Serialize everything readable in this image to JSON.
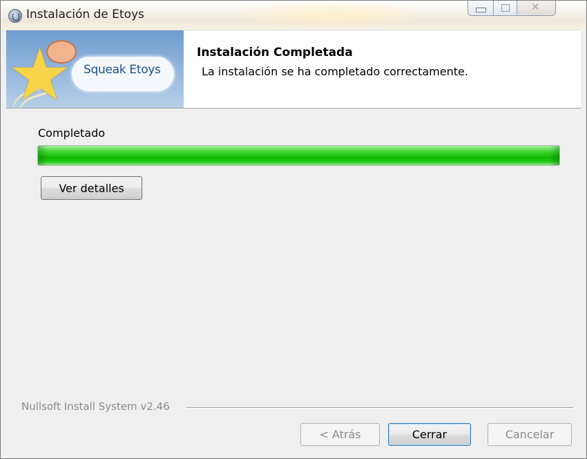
{
  "window": {
    "title": "Instalación de Etoys"
  },
  "header": {
    "logo_text": "Squeak Etoys",
    "title": "Instalación Completada",
    "subtitle": "La instalación se ha completado correctamente."
  },
  "status": {
    "label": "Completado",
    "progress_fraction": 1.0,
    "progress_color": "#13b905"
  },
  "buttons": {
    "details": "Ver detalles",
    "back": "< Atrás",
    "close": "Cerrar",
    "cancel": "Cancelar"
  },
  "footer": {
    "brand": "Nullsoft Install System v2.46"
  },
  "icons": {
    "app": "etoys-app-icon",
    "minimize": "minimize-icon",
    "maximize": "maximize-icon",
    "close": "close-icon"
  }
}
